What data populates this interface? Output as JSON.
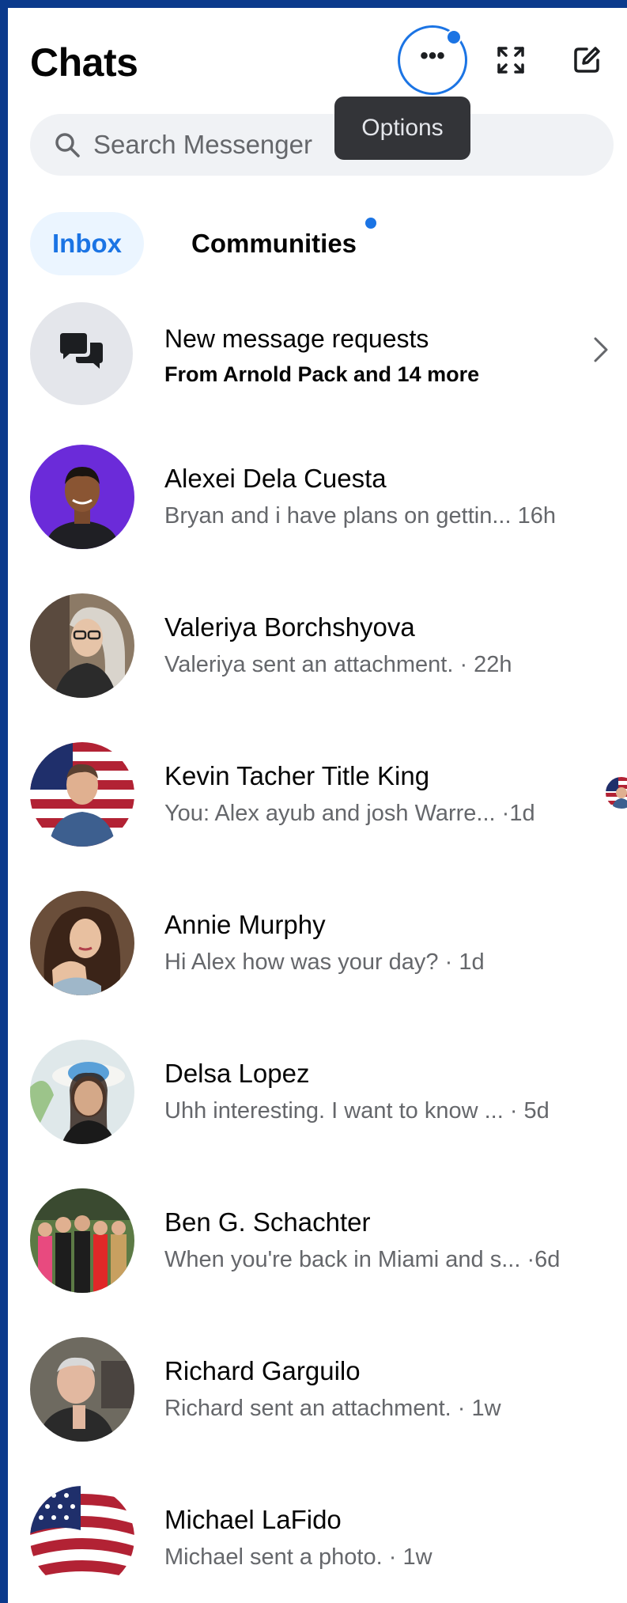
{
  "header": {
    "title": "Chats",
    "options_tooltip": "Options"
  },
  "search": {
    "placeholder": "Search Messenger"
  },
  "tabs": [
    {
      "label": "Inbox"
    },
    {
      "label": "Communities"
    }
  ],
  "requests": {
    "title": "New message requests",
    "subtitle": "From Arnold Pack and 14 more"
  },
  "chats": [
    {
      "name": "Alexei Dela Cuesta",
      "preview": "Bryan and i have plans on gettin...  16h"
    },
    {
      "name": "Valeriya Borchshyova",
      "preview": "Valeriya sent an attachment. · 22h"
    },
    {
      "name": "Kevin Tacher Title King",
      "preview": "You: Alex ayub and josh Warre...  ·1d"
    },
    {
      "name": "Annie Murphy",
      "preview": "Hi Alex how was your day? · 1d"
    },
    {
      "name": "Delsa Lopez",
      "preview": "Uhh interesting. I want to know ...   · 5d"
    },
    {
      "name": "Ben G. Schachter",
      "preview": "When you're back in Miami and s... ·6d"
    },
    {
      "name": "Richard Garguilo",
      "preview": "Richard sent an attachment. · 1w"
    },
    {
      "name": "Michael LaFido",
      "preview": "Michael sent a photo. · 1w"
    }
  ],
  "colors": {
    "accent": "#1b74e4",
    "frame": "#0b3a8c",
    "secondary_text": "#65676b"
  }
}
